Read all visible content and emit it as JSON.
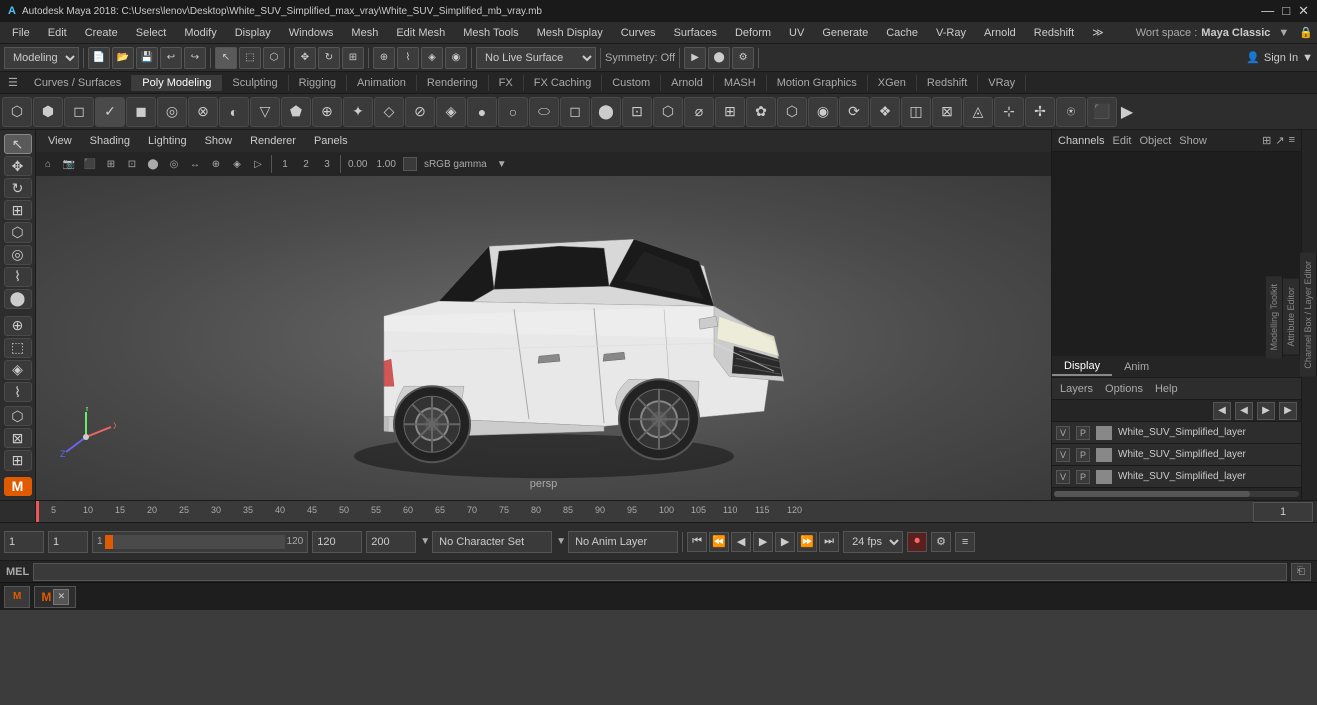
{
  "titlebar": {
    "icon": "M",
    "title": "Autodesk Maya 2018: C:\\Users\\lenov\\Desktop\\White_SUV_Simplified_max_vray\\White_SUV_Simplified_mb_vray.mb",
    "minimize": "—",
    "maximize": "□",
    "close": "✕"
  },
  "menubar": {
    "items": [
      "File",
      "Edit",
      "Create",
      "Select",
      "Modify",
      "Display",
      "Windows",
      "Mesh",
      "Edit Mesh",
      "Mesh Tools",
      "Mesh Display",
      "Curves",
      "Surfaces",
      "Deform",
      "UV",
      "Generate",
      "Cache",
      "V-Ray",
      "Arnold",
      "Redshift"
    ]
  },
  "toolbar": {
    "workspace_label": "Wort space :",
    "workspace_value": "Maya Classic",
    "sign_in": "Sign In",
    "modeling_label": "Modeling"
  },
  "tabs": {
    "items": [
      "Curves / Surfaces",
      "Poly Modeling",
      "Sculpting",
      "Rigging",
      "Animation",
      "Rendering",
      "FX",
      "FX Caching",
      "Custom",
      "Arnold",
      "MASH",
      "Motion Graphics",
      "XGen",
      "Redshift",
      "VRay"
    ]
  },
  "viewport": {
    "menu_items": [
      "View",
      "Shading",
      "Lighting",
      "Show",
      "Renderer",
      "Panels"
    ],
    "persp_label": "persp",
    "gamma": "sRGB gamma",
    "float_val1": "0.00",
    "float_val2": "1.00"
  },
  "channels": {
    "header_tabs": [
      "Channels",
      "Edit",
      "Object",
      "Show"
    ],
    "lower_tabs": [
      "Display",
      "Anim"
    ],
    "layers_label": "Layers",
    "options_label": "Options",
    "help_label": "Help"
  },
  "layers": {
    "items": [
      {
        "v": "V",
        "p": "P",
        "name": "White_SUV_Simplified_layer"
      },
      {
        "v": "V",
        "p": "P",
        "name": "White_SUV_Simplified_layer"
      },
      {
        "v": "V",
        "p": "P",
        "name": "White_SUV_Simplified_layer"
      }
    ]
  },
  "timeline": {
    "ticks": [
      "5",
      "10",
      "15",
      "20",
      "25",
      "30",
      "35",
      "40",
      "45",
      "50",
      "55",
      "60",
      "65",
      "70",
      "75",
      "80",
      "85",
      "90",
      "95",
      "100",
      "105",
      "110",
      "115",
      "120"
    ],
    "frame_current": "1",
    "frame_start": "1",
    "frame_range_start": "120",
    "frame_range_end": "120",
    "frame_end": "200",
    "fps": "24 fps"
  },
  "bottom": {
    "frame1": "1",
    "frame2": "1",
    "frame3": "1",
    "range_end": "120",
    "char_set": "No Character Set",
    "anim_layer": "No Anim Layer",
    "fps": "24 fps"
  },
  "mel": {
    "label": "MEL",
    "placeholder": ""
  },
  "taskbar": {
    "maya_icon": "M",
    "app_title": "M"
  },
  "right_side": {
    "channel_box_label": "Channel Box / Layer Editor",
    "modelling_toolkit": "Modelling Toolkit",
    "attribute_editor": "Attribute Editor"
  },
  "icons": {
    "arrow": "↖",
    "move": "✥",
    "rotate": "↻",
    "scale": "⊞",
    "select": "⬚",
    "lasso": "⌇",
    "paint": "🖌",
    "snap": "⊕"
  }
}
